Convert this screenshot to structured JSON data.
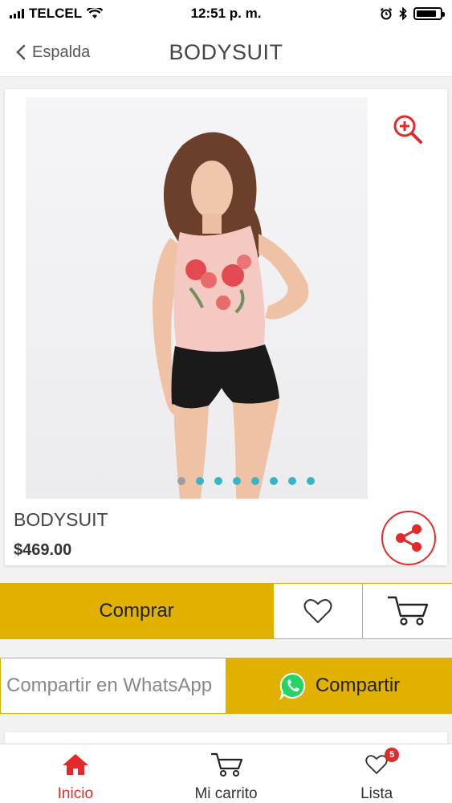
{
  "status_bar": {
    "carrier": "TELCEL",
    "time": "12:51 p. m.",
    "battery_level": 0.85
  },
  "nav": {
    "back_label": "Espalda",
    "title": "BODYSUIT"
  },
  "product": {
    "name": "BODYSUIT",
    "price": "$469.00",
    "image_count": 8,
    "active_image": 1
  },
  "actions": {
    "buy_label": "Comprar",
    "favorite_icon": "heart-outline-icon",
    "cart_icon": "cart-icon"
  },
  "whatsapp": {
    "placeholder": "Compartir en WhatsApp",
    "share_label": "Compartir"
  },
  "tabs": [
    {
      "label": "Inicio",
      "icon": "home-icon",
      "active": true
    },
    {
      "label": "Mi carrito",
      "icon": "cart-icon",
      "active": false
    },
    {
      "label": "Lista",
      "icon": "heart-icon",
      "active": false,
      "badge": "5"
    }
  ],
  "colors": {
    "accent": "#e12a2a",
    "gold": "#e0b100",
    "dot": "#39b4c4",
    "whatsapp": "#25d366"
  }
}
